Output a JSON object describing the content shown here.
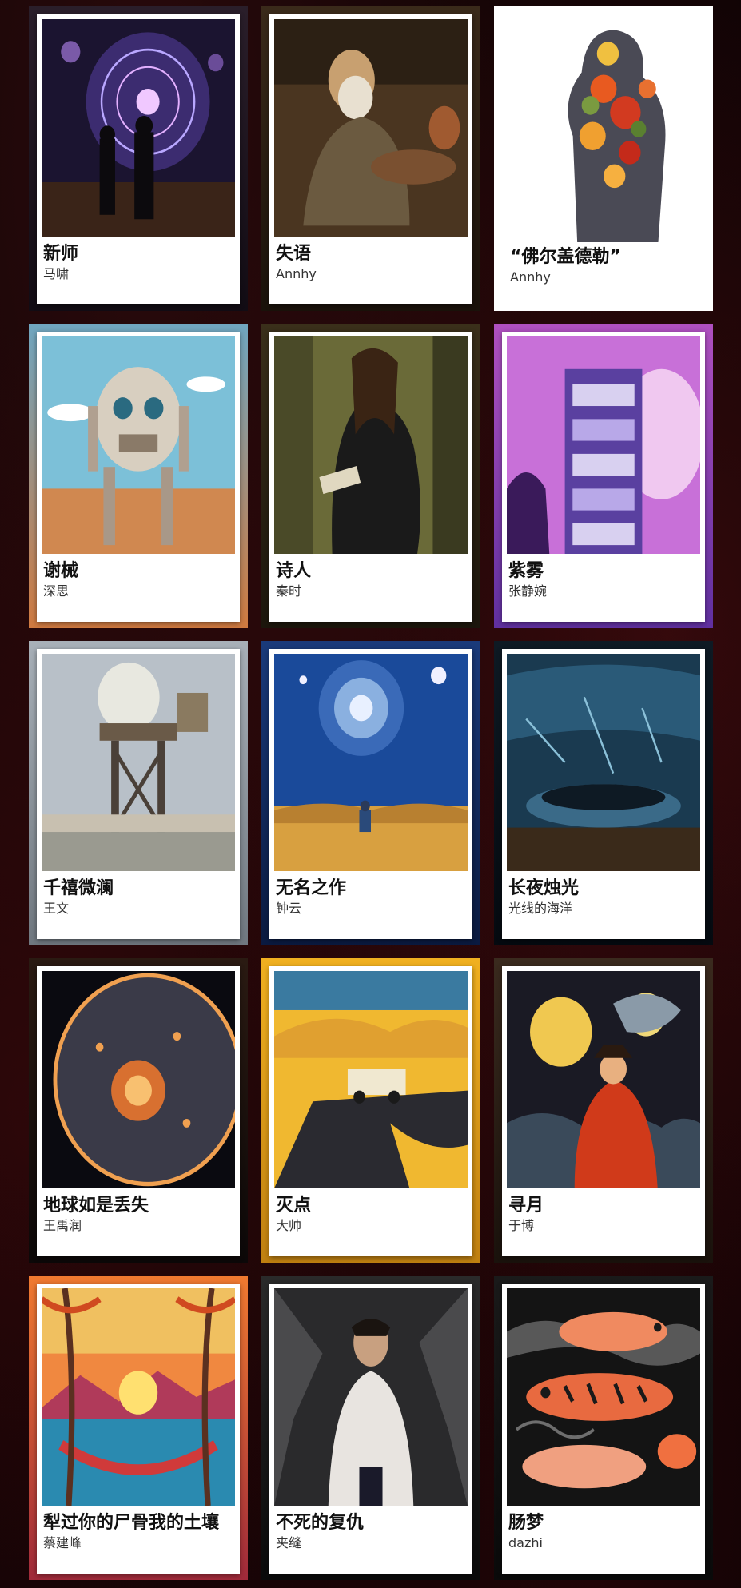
{
  "cards": [
    {
      "title": "新师",
      "author": "马啸"
    },
    {
      "title": "失语",
      "author": "Annhy"
    },
    {
      "title": "“佛尔盖德勒”",
      "author": "Annhy"
    },
    {
      "title": "谢械",
      "author": "深思"
    },
    {
      "title": "诗人",
      "author": "秦时"
    },
    {
      "title": "紫雾",
      "author": "张静婉"
    },
    {
      "title": "千禧微澜",
      "author": "王文"
    },
    {
      "title": "无名之作",
      "author": "钟云"
    },
    {
      "title": "长夜烛光",
      "author": "光线的海洋"
    },
    {
      "title": "地球如是丢失",
      "author": "王禹润"
    },
    {
      "title": "灭点",
      "author": "大帅"
    },
    {
      "title": "寻月",
      "author": "于博"
    },
    {
      "title": "犁过你的尸骨我的土壤",
      "author": "蔡建峰"
    },
    {
      "title": "不死的复仇",
      "author": "夹缝"
    },
    {
      "title": "肠梦",
      "author": "dazhi"
    }
  ]
}
